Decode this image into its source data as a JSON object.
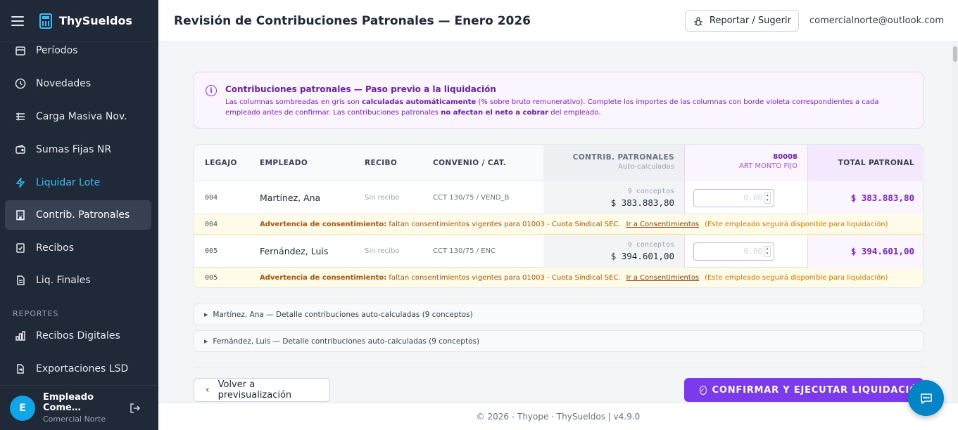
{
  "app": {
    "name": "ThySueldos"
  },
  "sidebar": {
    "items": [
      {
        "label": "Períodos",
        "icon": "calendar-icon"
      },
      {
        "label": "Novedades",
        "icon": "clock-icon"
      },
      {
        "label": "Carga Masiva Nov.",
        "icon": "list-icon"
      },
      {
        "label": "Sumas Fijas NR",
        "icon": "wallet-icon"
      },
      {
        "label": "Liquidar Lote",
        "icon": "bolt-icon"
      },
      {
        "label": "Contrib. Patronales",
        "icon": "building-icon"
      },
      {
        "label": "Recibos",
        "icon": "receipt-icon"
      },
      {
        "label": "Liq. Finales",
        "icon": "document-icon"
      }
    ],
    "section_label": "REPORTES",
    "report_items": [
      {
        "label": "Recibos Digitales",
        "icon": "bar-chart-icon"
      },
      {
        "label": "Exportaciones LSD",
        "icon": "export-icon"
      }
    ],
    "active_item": "Contrib. Patronales",
    "highlight_item": "Liquidar Lote",
    "user": {
      "initial": "E",
      "name": "Empleado Come…",
      "company": "Comercial Norte"
    }
  },
  "header": {
    "title": "Revisión de Contribuciones Patronales — Enero 2026",
    "report_button": "Reportar / Sugerir",
    "email": "comercialnorte@outlook.com"
  },
  "info": {
    "title": "Contribuciones patronales — Paso previo a la liquidación",
    "text_1": "Las columnas sombreadas en gris son ",
    "text_bold_1": "calculadas automáticamente",
    "text_2": " (% sobre bruto remunerativo). Complete los importes de las columnas con borde violeta correspondientes a cada empleado antes de confirmar. Las contribuciones patronales ",
    "text_bold_2": "no afectan el neto a cobrar",
    "text_3": " del empleado."
  },
  "table": {
    "headers": {
      "legajo": "LEGAJO",
      "empleado": "EMPLEADO",
      "recibo": "RECIBO",
      "convenio": "CONVENIO / CAT.",
      "contrib": "CONTRIB. PATRONALES",
      "contrib_sub": "Auto-calculadas",
      "art_code": "80008",
      "art_label": "ART MONTO FIJO",
      "total": "TOTAL PATRONAL"
    },
    "rows": [
      {
        "legajo": "004",
        "empleado": "Martínez, Ana",
        "recibo": "Sin recibo",
        "convenio": "CCT 130/75 / VEND_B",
        "conceptos": "9 conceptos",
        "contrib": "$ 383.883,80",
        "art_placeholder": "0.00",
        "total": "$ 383.883,80"
      },
      {
        "legajo": "005",
        "empleado": "Fernández, Luis",
        "recibo": "Sin recibo",
        "convenio": "CCT 130/75 / ENC",
        "conceptos": "9 conceptos",
        "contrib": "$ 394.601,00",
        "art_placeholder": "0.00",
        "total": "$ 394.601,00"
      }
    ],
    "warnings": [
      {
        "legajo": "004",
        "title": "Advertencia de consentimiento:",
        "text": " faltan consentimientos vigentes para 01003 - Cuota Sindical SEC.",
        "link": "Ir a Consentimientos",
        "note": "(Este empleado seguirá disponible para liquidación)"
      },
      {
        "legajo": "005",
        "title": "Advertencia de consentimiento:",
        "text": " faltan consentimientos vigentes para 01003 - Cuota Sindical SEC.",
        "link": "Ir a Consentimientos",
        "note": "(Este empleado seguirá disponible para liquidación)"
      }
    ]
  },
  "details": [
    "Martínez, Ana — Detalle contribuciones auto-calculadas (9 conceptos)",
    "Fernández, Luis — Detalle contribuciones auto-calculadas (9 conceptos)"
  ],
  "actions": {
    "back": "Volver a previsualización",
    "confirm": "CONFIRMAR Y EJECUTAR LIQUIDACIÓN"
  },
  "footer": "© 2026 - Thyope · ThySueldos | v4.9.0",
  "colors": {
    "sidebar_bg": "#1f2937",
    "accent": "#7c3aed",
    "highlight": "#38bdf8",
    "warning": "#b45309",
    "chat_fab": "#0284c7"
  }
}
